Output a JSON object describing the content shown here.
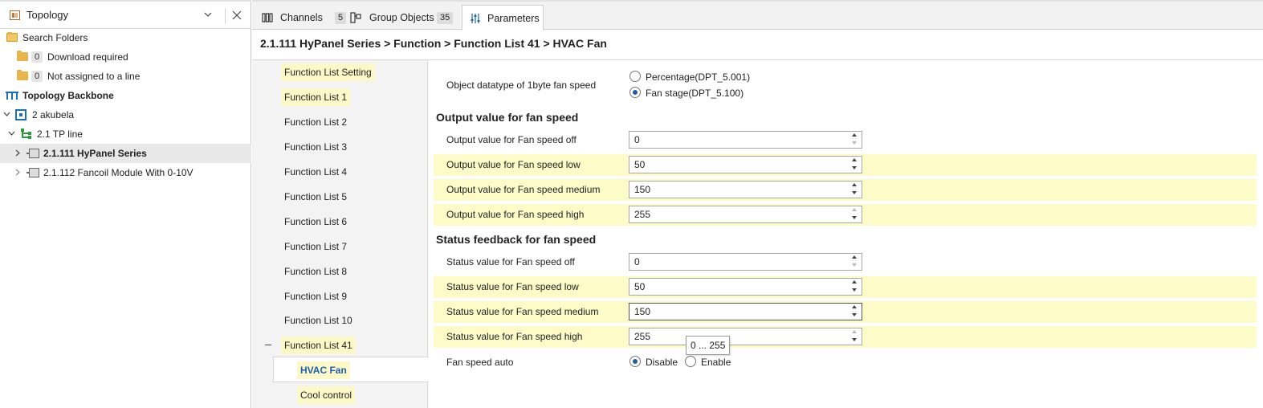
{
  "colors": {
    "highlight_row": "#fdfbc8",
    "accent_blue": "#1a5fb4",
    "folder": "#e9b44c"
  },
  "left_panel": {
    "title": "Topology",
    "icons": {
      "header": "topology-icon",
      "dropdown": "chevron-down-icon",
      "close": "close-icon"
    },
    "tree": {
      "search_folders": "Search Folders",
      "download_required": {
        "count": "0",
        "label": "Download required"
      },
      "not_assigned": {
        "count": "0",
        "label": "Not assigned to a line"
      },
      "backbone": "Topology Backbone",
      "area": "2 akubela",
      "line": "2.1 TP line",
      "device1": "2.1.111 HyPanel Series",
      "device2": "2.1.112 Fancoil Module With 0-10V"
    }
  },
  "tabs": [
    {
      "label": "Channels",
      "badge": "5",
      "icon": "channels-icon"
    },
    {
      "label": "Group Objects",
      "badge": "35",
      "icon": "group-objects-icon"
    },
    {
      "label": "Parameters",
      "badge": "",
      "icon": "parameters-icon"
    }
  ],
  "breadcrumb": "2.1.111 HyPanel Series > Function > Function List 41 > HVAC Fan",
  "function_list": [
    "Function List Setting",
    "Function List 1",
    "Function List 2",
    "Function List 3",
    "Function List 4",
    "Function List 5",
    "Function List 6",
    "Function List 7",
    "Function List 8",
    "Function List 9",
    "Function List 10",
    "Function List 41",
    "HVAC Fan",
    "Cool control"
  ],
  "form": {
    "datatype": {
      "label": "Object datatype of 1byte fan speed",
      "option1": "Percentage(DPT_5.001)",
      "option2": "Fan stage(DPT_5.100)",
      "selected": "option2"
    },
    "output_section": "Output value for fan speed",
    "output_rows": [
      {
        "label": "Output value for Fan speed off",
        "value": "0"
      },
      {
        "label": "Output value for Fan speed low",
        "value": "50"
      },
      {
        "label": "Output value for Fan speed medium",
        "value": "150"
      },
      {
        "label": "Output value for Fan speed high",
        "value": "255"
      }
    ],
    "status_section": "Status feedback for fan speed",
    "status_rows": [
      {
        "label": "Status value for Fan speed off",
        "value": "0"
      },
      {
        "label": "Status value for Fan speed low",
        "value": "50"
      },
      {
        "label": "Status value for Fan speed medium",
        "value": "150"
      },
      {
        "label": "Status value for Fan speed high",
        "value": "255"
      }
    ],
    "fan_auto": {
      "label": "Fan speed auto",
      "option1": "Disable",
      "option2": "Enable",
      "selected": "option1"
    },
    "tooltip": "0 ... 255"
  }
}
